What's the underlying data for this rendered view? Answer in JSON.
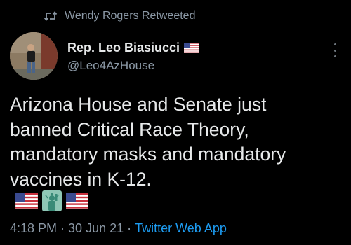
{
  "retweet": {
    "icon": "retweet-icon",
    "text": "Wendy Rogers Retweeted"
  },
  "author": {
    "display_name": "Rep. Leo Biasiucci",
    "name_emoji": "us-flag-icon",
    "handle": "@Leo4AzHouse"
  },
  "tweet": {
    "text": "Arizona House and Senate just\nbanned Critical Race Theory,\nmandatory masks and mandatory\nvaccines in K-12.",
    "emojis": [
      "us-flag-icon",
      "statue-of-liberty-icon",
      "us-flag-icon"
    ]
  },
  "meta": {
    "time": "4:18 PM",
    "date": "30 Jun 21",
    "separator": "·",
    "source": "Twitter Web App"
  },
  "colors": {
    "background": "#000000",
    "text": "#e7e9ea",
    "muted": "#8b98a5",
    "link": "#1d9bf0"
  }
}
